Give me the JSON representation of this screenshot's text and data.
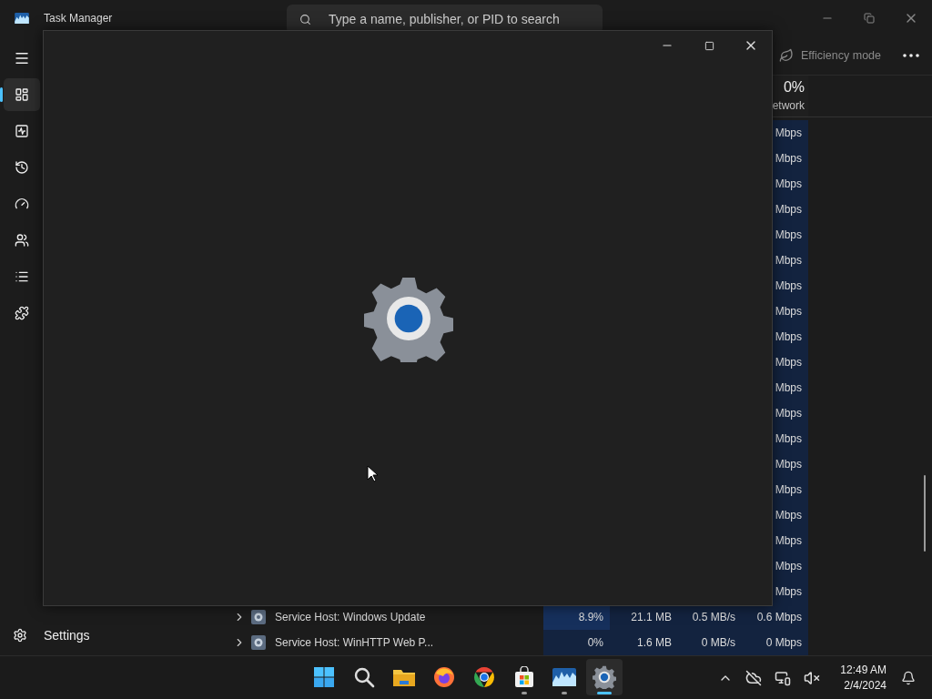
{
  "window": {
    "title": "Task Manager"
  },
  "search": {
    "placeholder": "Type a name, publisher, or PID to search"
  },
  "sidebar": {
    "items": [
      {
        "kind": "processes",
        "selected": true
      },
      {
        "kind": "performance",
        "selected": false
      },
      {
        "kind": "history",
        "selected": false
      },
      {
        "kind": "startup",
        "selected": false
      },
      {
        "kind": "users",
        "selected": false
      },
      {
        "kind": "details",
        "selected": false
      },
      {
        "kind": "services",
        "selected": false
      }
    ],
    "footer": {
      "label": "Settings"
    }
  },
  "toolbar": {
    "efficiency_mode": {
      "label": "Efficiency mode",
      "disabled": true
    }
  },
  "table": {
    "network_header": {
      "value": "0%",
      "label": "etwork"
    },
    "rows": [
      {
        "network": "Mbps"
      },
      {
        "network": "Mbps"
      },
      {
        "network": "Mbps"
      },
      {
        "network": "Mbps"
      },
      {
        "network": "Mbps"
      },
      {
        "network": "Mbps"
      },
      {
        "network": "Mbps"
      },
      {
        "network": "Mbps"
      },
      {
        "network": "Mbps"
      },
      {
        "network": "Mbps"
      },
      {
        "network": "Mbps"
      },
      {
        "network": "Mbps"
      },
      {
        "network": "Mbps"
      },
      {
        "network": "Mbps"
      },
      {
        "network": "Mbps"
      },
      {
        "network": "Mbps"
      },
      {
        "network": "Mbps"
      },
      {
        "network": "Mbps"
      },
      {
        "network": "Mbps"
      },
      {
        "name": "Service Host: Windows Update",
        "cpu": "8.9%",
        "memory": "21.1 MB",
        "disk": "0.5 MB/s",
        "network": "0.6 Mbps"
      },
      {
        "name": "Service Host: WinHTTP Web P...",
        "cpu": "0%",
        "memory": "1.6 MB",
        "disk": "0 MB/s",
        "network": "0 Mbps"
      }
    ]
  },
  "taskbar": {
    "apps": [
      {
        "kind": "start",
        "running": false,
        "selected": false
      },
      {
        "kind": "search",
        "running": false,
        "selected": false
      },
      {
        "kind": "files",
        "running": false,
        "selected": false
      },
      {
        "kind": "firefox",
        "running": false,
        "selected": false
      },
      {
        "kind": "chrome",
        "running": false,
        "selected": false
      },
      {
        "kind": "store",
        "running": true,
        "selected": false
      },
      {
        "kind": "taskmanager",
        "running": true,
        "selected": false
      },
      {
        "kind": "settings",
        "running": true,
        "selected": true
      }
    ],
    "tray": [
      {
        "kind": "chevron"
      },
      {
        "kind": "cloud"
      },
      {
        "kind": "network"
      },
      {
        "kind": "volume"
      }
    ],
    "clock": {
      "time": "12:49 AM",
      "date": "2/4/2024"
    }
  }
}
